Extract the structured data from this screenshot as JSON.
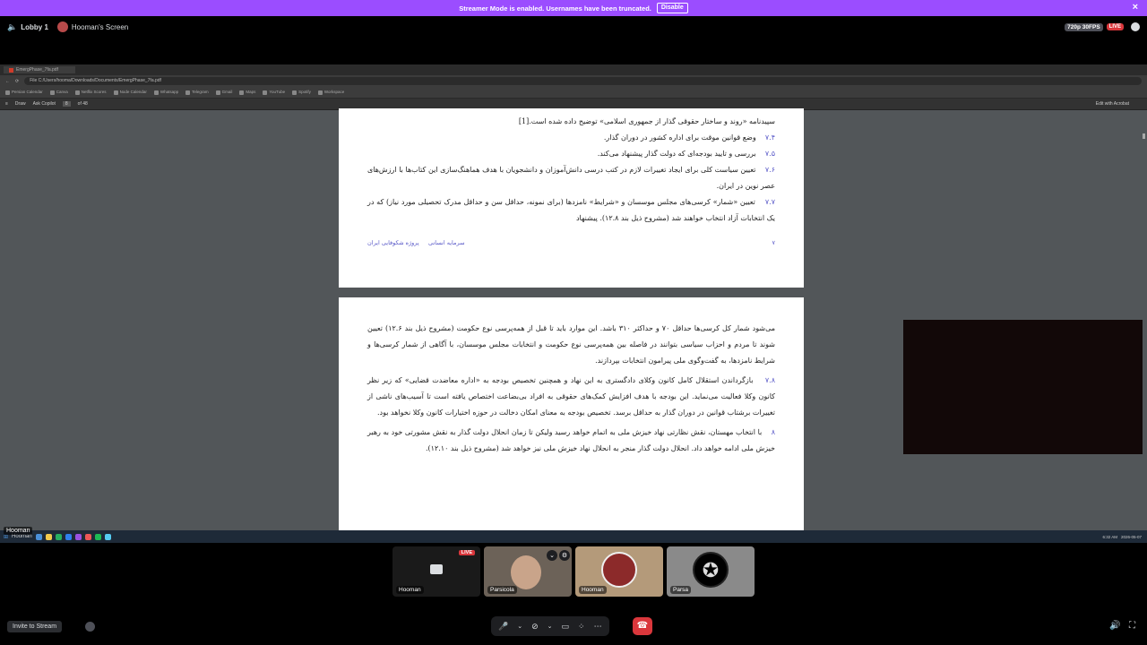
{
  "banner": {
    "text": "Streamer Mode is enabled. Usernames have been truncated.",
    "disable_label": "Disable",
    "close_glyph": "×"
  },
  "topbar": {
    "volume_glyph": "🔈",
    "channel": "Lobby 1",
    "screen_title": "Hooman's Screen",
    "quality": "720p 30FPS",
    "live": "LIVE"
  },
  "browser": {
    "tab_title": "EmergPhase_7fa.pdf",
    "address": "File   C:/Users/hooma/Downloads/Documents/EmergPhase_7fa.pdf",
    "bookmarks": [
      "Persian Calendar",
      "Canva",
      "Netflix Scores",
      "Node Calendar",
      "Whatsapp",
      "Telegram",
      "Gmail",
      "Maps",
      "YouTube",
      "Spotify",
      "Workspace"
    ],
    "toolbar": {
      "draw": "Draw",
      "ask_copilot": "Ask Copilot",
      "page": "8",
      "of": "of 48",
      "edit": "Edit with Acrobat"
    }
  },
  "pdf": {
    "page1": [
      {
        "num": "",
        "text": "سپیدنامه «روند و ساختار حقوقی گذار از جمهوری اسلامی» توضیح داده شده است.[1]"
      },
      {
        "num": "۷.۴",
        "text": "وضع قوانین موقت برای اداره کشور در دوران گذار."
      },
      {
        "num": "۷.۵",
        "text": "بررسی و تایید بودجه‌ای که دولت گذار پیشنهاد می‌کند."
      },
      {
        "num": "۷.۶",
        "text": "تعیین سیاست کلی برای ایجاد تغییرات لازم در کتب درسی دانش‌آموزان و دانشجویان با هدف هماهنگ‌سازی این کتاب‌ها با ارزش‌های عصر نوین در ایران."
      },
      {
        "num": "۷.۷",
        "text": "تعیین «شمار» کرسی‌های مجلس موسسان و «شرایط» نامزدها (برای نمونه، حداقل سن و حداقل مدرک تحصیلی مورد نیاز) که در یک انتخابات آزاد انتخاب خواهند شد (مشروح ذیل بند ۱۲.۸). پیشنهاد"
      }
    ],
    "footer_left": "سرمایه انسانی",
    "footer_mid": "پروژه شکوفایی ایران",
    "footer_page": "۷",
    "page2": [
      {
        "num": "",
        "text": "می‌شود شمار کل کرسی‌ها حداقل ۷۰ و حداکثر ۳۱۰ باشد. این موارد باید تا قبل از همه‌پرسی نوع حکومت (مشروح ذیل بند ۱۲.۶) تعیین شوند تا مردم و احزاب سیاسی بتوانند در فاصله بین همه‌پرسی نوع حکومت و انتخابات مجلس موسسان، با آگاهی از شمار کرسی‌ها و شرایط نامزدها، به گفت‌وگوی ملی پیرامون انتخابات بپردازند."
      },
      {
        "num": "۷.۸",
        "text": "بازگرداندن استقلال کامل کانون وکلای دادگستری به این نهاد و همچنین تخصیص بودجه به «اداره معاضدت قضایی» که زیر نظر کانون وکلا فعالیت می‌نماید. این بودجه با هدف افزایش کمک‌های حقوقی به افراد بی‌بضاعت اختصاص یافته است تا آسیب‌های ناشی از تغییرات برشتاب قوانین در دوران گذار به حداقل برسد. تخصیص بودجه به معنای امکان دخالت در حوزه اختیارات کانون وکلا نخواهد بود."
      },
      {
        "num": "۸",
        "text": "با انتخاب مهستان، نقش نظارتی نهاد خیزش ملی به اتمام خواهد رسید ولیکن تا زمان انحلال دولت گذار به نقش مشورتی خود به رهبر خیزش ملی ادامه خواهد داد. انحلال دولت گذار منجر به انحلال نهاد خیزش ملی نیز خواهد شد (مشروح ذیل بند ۱۲.۱۰)."
      }
    ]
  },
  "taskbar": {
    "user": "Hooman",
    "time": "6:32 AM",
    "date": "2026-05-07"
  },
  "tiles": [
    {
      "name": "Hooman",
      "type": "stream",
      "live": "LIVE"
    },
    {
      "name": "Parsicola",
      "type": "camera"
    },
    {
      "name": "Hooman",
      "type": "avatar"
    },
    {
      "name": "Parsa",
      "type": "avatar"
    }
  ],
  "bottom": {
    "invite": "Invite to Stream"
  },
  "colors": {
    "banner": "#9b4dff",
    "live": "#da373c",
    "end_call": "#da373c"
  }
}
